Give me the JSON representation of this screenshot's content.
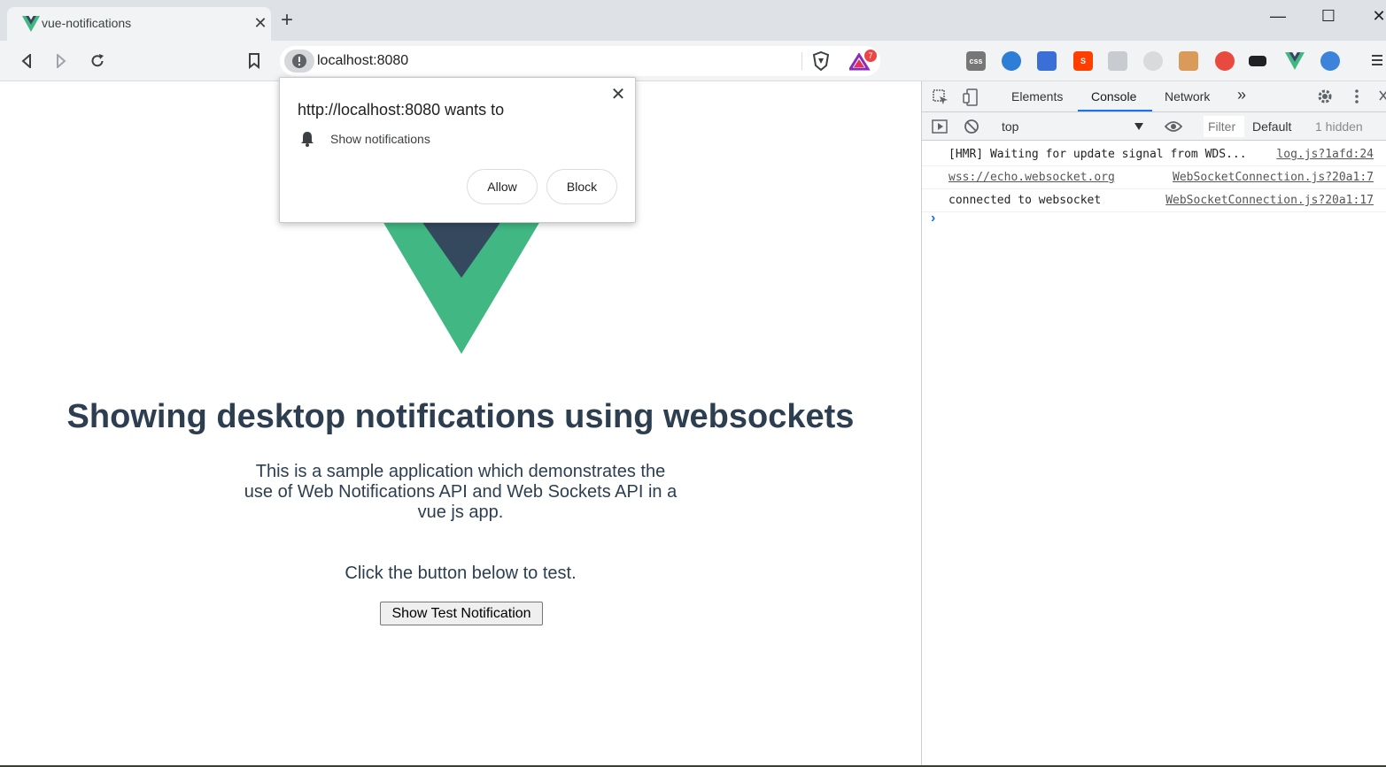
{
  "browser": {
    "tab_title": "vue-notifications",
    "tab_close": "✕",
    "new_tab": "+",
    "url": "localhost:8080",
    "window_controls": {
      "minimize": "—",
      "maximize": "☐",
      "close": "✕"
    },
    "brave_badge": "7",
    "extension_icons": [
      "css-icon",
      "dashlane-icon",
      "analytics-icon",
      "svelte-icon",
      "screenshot-icon",
      "camera-icon",
      "cookie-icon",
      "graph-icon",
      "keyboard-icon",
      "vue-devtools-icon",
      "globe-icon"
    ]
  },
  "permission_popup": {
    "title": "http://localhost:8080 wants to",
    "permission_label": "Show notifications",
    "allow_label": "Allow",
    "block_label": "Block",
    "close": "✕"
  },
  "page": {
    "heading": "Showing desktop notifications using websockets",
    "description": "This is a sample application which demonstrates the use of Web Notifications API and Web Sockets API in a vue js app.",
    "hint": "Click the button below to test.",
    "button_label": "Show Test Notification",
    "logo_colors": {
      "outer": "#41b883",
      "inner": "#35495e"
    }
  },
  "devtools": {
    "tabs": [
      "Elements",
      "Console",
      "Network"
    ],
    "active_tab": "Console",
    "more_tabs": "»",
    "context": "top",
    "filter_placeholder": "Filter",
    "levels": "Default",
    "hidden_count": "1 hidden",
    "logs": [
      {
        "message": "[HMR] Waiting for update signal from WDS...",
        "source": "log.js?1afd:24"
      },
      {
        "message": "wss://echo.websocket.org",
        "source": "WebSocketConnection.js?20a1:7"
      },
      {
        "message": "connected to websocket",
        "source": "WebSocketConnection.js?20a1:17"
      }
    ],
    "prompt": "›"
  }
}
